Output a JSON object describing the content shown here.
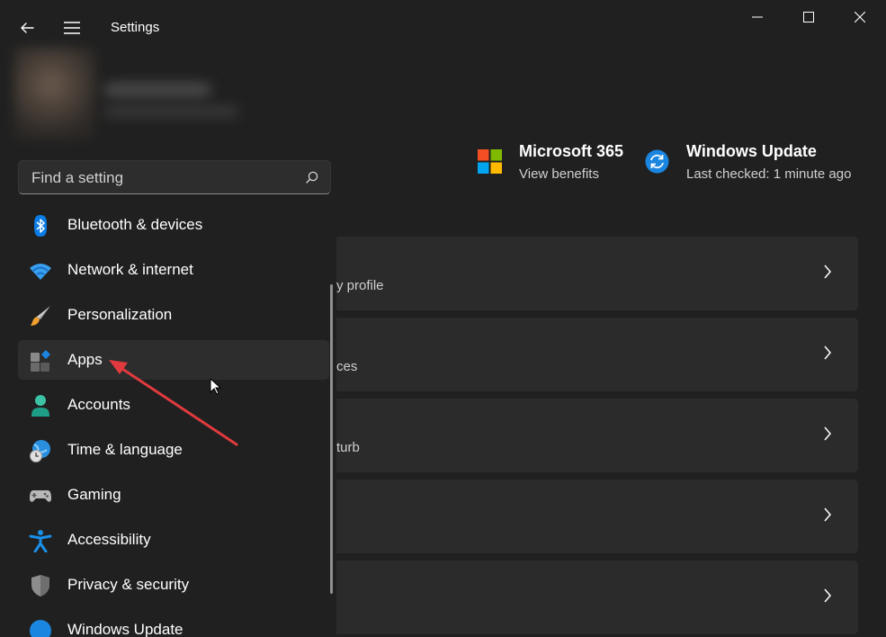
{
  "window": {
    "title": "Settings"
  },
  "search": {
    "placeholder": "Find a setting"
  },
  "nav": {
    "items": [
      {
        "label": "Bluetooth & devices",
        "icon": "bluetooth-icon"
      },
      {
        "label": "Network & internet",
        "icon": "wifi-icon"
      },
      {
        "label": "Personalization",
        "icon": "brush-icon"
      },
      {
        "label": "Apps",
        "icon": "apps-icon",
        "active": true
      },
      {
        "label": "Accounts",
        "icon": "person-icon"
      },
      {
        "label": "Time & language",
        "icon": "globe-clock-icon"
      },
      {
        "label": "Gaming",
        "icon": "gamepad-icon"
      },
      {
        "label": "Accessibility",
        "icon": "accessibility-icon"
      },
      {
        "label": "Privacy & security",
        "icon": "shield-icon"
      },
      {
        "label": "Windows Update",
        "icon": "update-icon"
      }
    ]
  },
  "promos": {
    "microsoft365": {
      "title": "Microsoft 365",
      "subtitle": "View benefits",
      "icon": "microsoft-logo-icon"
    },
    "windows_update": {
      "title": "Windows Update",
      "subtitle": "Last checked: 1 minute ago",
      "icon": "sync-icon"
    }
  },
  "cards": [
    {
      "subtitle": "y profile"
    },
    {
      "subtitle": "ces"
    },
    {
      "subtitle": "turb"
    },
    {
      "subtitle": ""
    },
    {
      "subtitle": ""
    }
  ],
  "colors": {
    "background": "#202020",
    "card": "#2b2b2b",
    "active_item": "#2d2d2d",
    "accent_blue": "#0078d4",
    "annotation_arrow": "#e03a3e"
  }
}
